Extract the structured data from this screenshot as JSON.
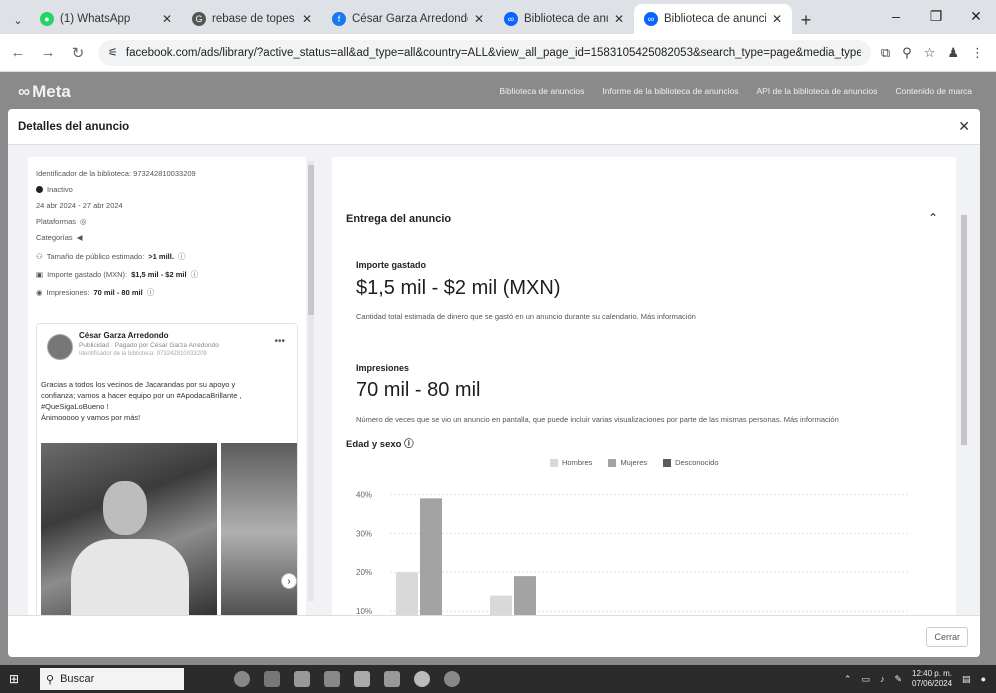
{
  "browser": {
    "tabs": [
      {
        "title": "(1) WhatsApp",
        "icon": "whatsapp-icon",
        "color": "#25D366",
        "active": false
      },
      {
        "title": "rebase de topes de gastos",
        "icon": "google-icon",
        "color": "#555555",
        "active": false
      },
      {
        "title": "César Garza Arredondo | Fa",
        "icon": "facebook-icon",
        "color": "#1877F2",
        "active": false
      },
      {
        "title": "Biblioteca de anuncios",
        "icon": "meta-icon",
        "color": "#0866FF",
        "active": false
      },
      {
        "title": "Biblioteca de anuncios",
        "icon": "meta-icon",
        "color": "#0866FF",
        "active": true
      }
    ],
    "url": "facebook.com/ads/library/?active_status=all&ad_type=all&country=ALL&view_all_page_id=1583105425082053&search_type=page&media_type=all"
  },
  "meta_header": {
    "logo": "Meta",
    "nav": [
      "Biblioteca de anuncios",
      "Informe de la biblioteca de anuncios",
      "API de la biblioteca de anuncios",
      "Contenido de marca"
    ]
  },
  "modal": {
    "title": "Detalles del anuncio",
    "close_label": "Cerrar",
    "ad": {
      "library_id": "Identificador de la biblioteca: 973242810033209",
      "status": "Inactivo",
      "dates": "24 abr 2024 - 27 abr 2024",
      "platforms_label": "Plataformas",
      "categories_label": "Categorías",
      "audience": "Tamaño de público estimado:",
      "audience_value": ">1 mill.",
      "spend": "Importe gastado (MXN):",
      "spend_value": "$1,5 mil - $2 mil",
      "impressions": "Impresiones:",
      "impressions_value": "70 mil - 80 mil"
    },
    "post": {
      "name": "César Garza Arredondo",
      "subtitle": "Publicidad · Pagado por César Garza Arredondo",
      "library_id": "Identificador de la biblioteca: 973242810033209",
      "text_lines": [
        "Gracias a todos los vecinos de Jacarandas por su apoyo y",
        "confianza; vamos a hacer equipo por un #ApodacaBrillante ,",
        "#QueSigaLoBueno !",
        "Ánimooooo y vamos por más!"
      ]
    },
    "delivery": {
      "section_title": "Entrega del anuncio",
      "spend_label": "Importe gastado",
      "spend_value": "$1,5 mil - $2 mil (MXN)",
      "spend_desc": "Cantidad total estimada de dinero que se gastó en un anuncio durante su calendario. Más información",
      "impressions_label": "Impresiones",
      "impressions_value": "70 mil - 80 mil",
      "impressions_desc": "Número de veces que se vio un anuncio en pantalla, que puede incluir varias visualizaciones por parte de las mismas personas. Más información",
      "age_title": "Edad y sexo"
    }
  },
  "chart_data": {
    "type": "bar",
    "title": "Edad y sexo",
    "series": [
      {
        "name": "Hombres",
        "color": "#d9d9d9",
        "values": [
          20,
          14
        ]
      },
      {
        "name": "Mujeres",
        "color": "#a3a3a3",
        "values": [
          39,
          19
        ]
      },
      {
        "name": "Desconocido",
        "color": "#5c5c5c",
        "values": [
          0,
          0
        ]
      }
    ],
    "yticks": [
      "40%",
      "30%",
      "20%",
      "10%"
    ],
    "ylim": [
      0,
      45
    ],
    "grid": true,
    "legend": "top"
  },
  "taskbar": {
    "search_label": "Buscar",
    "time": "12:40 p. m.",
    "date": "07/06/2024"
  }
}
